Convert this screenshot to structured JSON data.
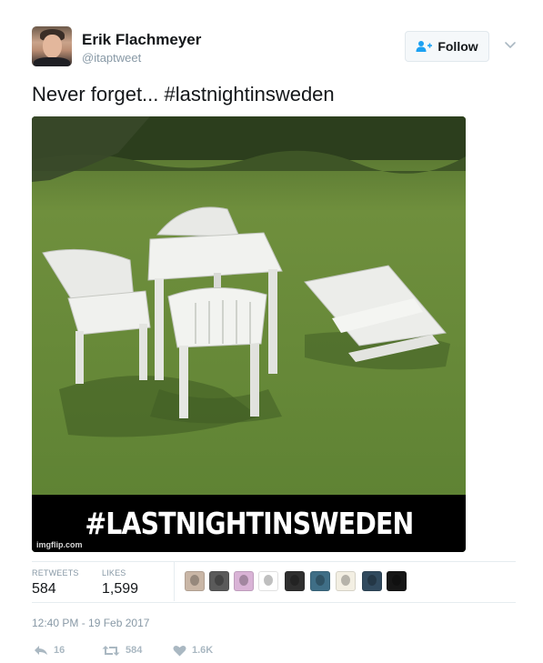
{
  "author": {
    "name": "Erik Flachmeyer",
    "handle": "@itaptweet",
    "avatar_icon": "user-photo"
  },
  "follow_button": {
    "label": "Follow",
    "icon": "add-user-icon"
  },
  "menu_icon": "chevron-down-icon",
  "tweet": {
    "text_prefix": "Never forget... ",
    "hashtag": "#lastnightinsweden"
  },
  "media": {
    "caption": "#LASTNIGHTINSWEDEN",
    "watermark": "imgflip.com",
    "description_icon": "lawn-chairs-photo"
  },
  "stats": {
    "retweets_label": "RETWEETS",
    "retweets_value": "584",
    "likes_label": "LIKES",
    "likes_value": "1,599"
  },
  "likers": [
    {
      "icon": "liker-avatar-1",
      "color": "#c9b6a6"
    },
    {
      "icon": "liker-avatar-2",
      "color": "#5a5a5a"
    },
    {
      "icon": "liker-avatar-3",
      "color": "#d9b3d6"
    },
    {
      "icon": "liker-avatar-4",
      "color": "#ffffff"
    },
    {
      "icon": "liker-avatar-5",
      "color": "#2f2f2f"
    },
    {
      "icon": "liker-avatar-6",
      "color": "#3f6e86"
    },
    {
      "icon": "liker-avatar-7",
      "color": "#f3efe3"
    },
    {
      "icon": "liker-avatar-8",
      "color": "#314a5e"
    },
    {
      "icon": "liker-avatar-9",
      "color": "#161616"
    }
  ],
  "timestamp": "12:40 PM - 19 Feb 2017",
  "actions": {
    "reply_count": "16",
    "retweet_count": "584",
    "like_count": "1.6K"
  },
  "colors": {
    "text": "#14171a",
    "muted": "#8899a6",
    "action": "#aab8c2",
    "border": "#e1e8ed"
  }
}
